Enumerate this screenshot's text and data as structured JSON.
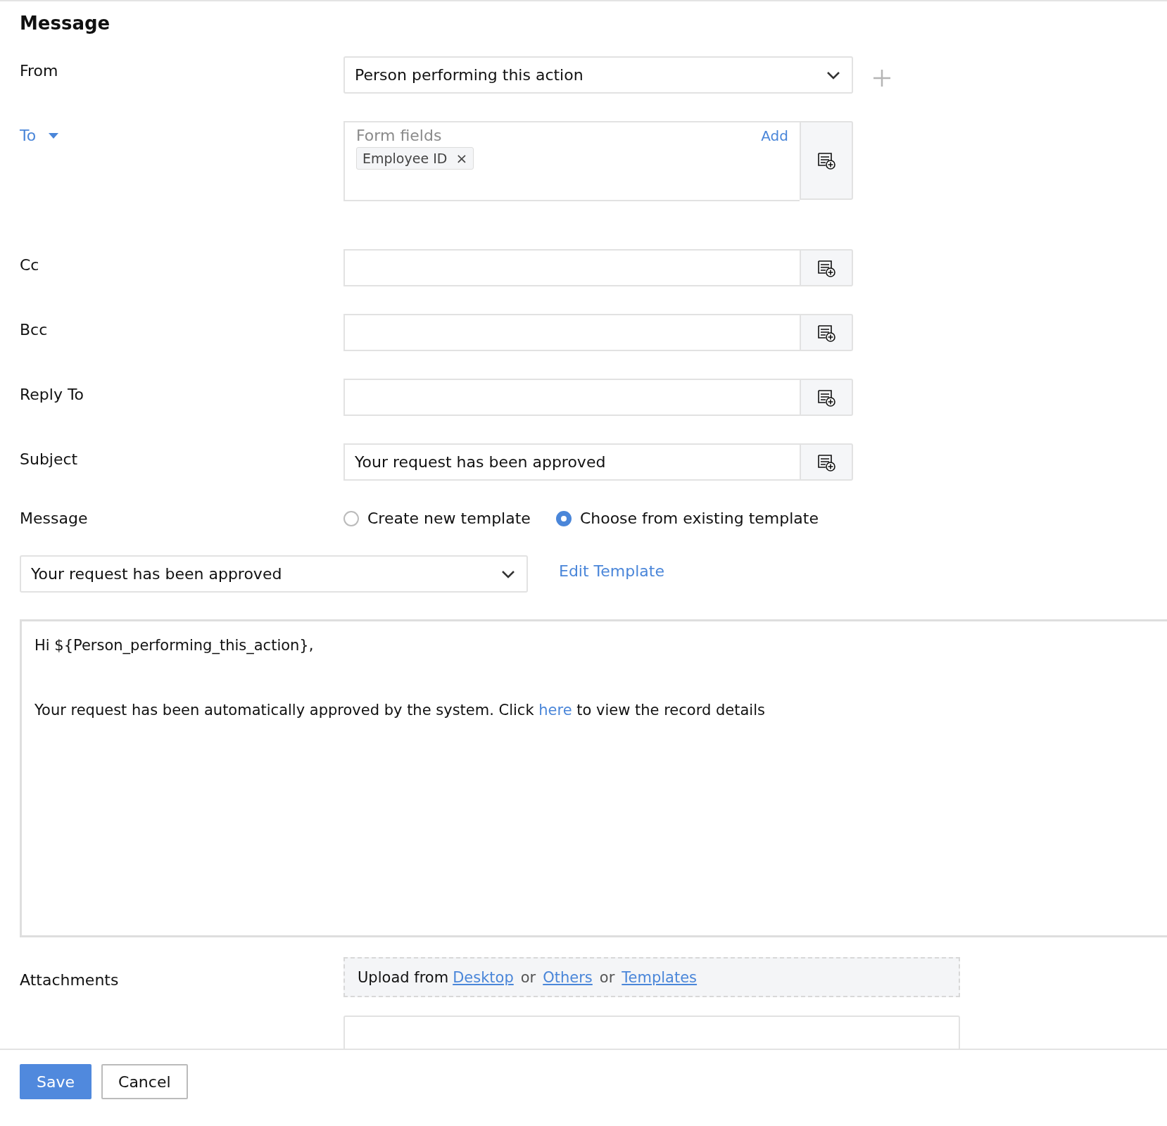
{
  "title": "Message",
  "from": {
    "label": "From",
    "value": "Person performing this action"
  },
  "to": {
    "label": "To",
    "placeholder": "Form fields",
    "add": "Add",
    "tokens": [
      {
        "label": "Employee ID",
        "remove": "×"
      }
    ]
  },
  "cc": {
    "label": "Cc"
  },
  "bcc": {
    "label": "Bcc"
  },
  "reply_to": {
    "label": "Reply To"
  },
  "subject": {
    "label": "Subject",
    "value": "Your request has been approved"
  },
  "message": {
    "label": "Message",
    "options": [
      {
        "label": "Create new template",
        "selected": false
      },
      {
        "label": "Choose from existing template",
        "selected": true
      }
    ],
    "template": "Your request has been approved",
    "edit": "Edit Template",
    "body": {
      "greeting": "Hi ${Person_performing_this_action},",
      "before": "Your request has been automatically approved by the system. Click ",
      "link": "here",
      "after": " to view the record details"
    }
  },
  "attachments": {
    "label": "Attachments",
    "parts": [
      {
        "kind": "text",
        "text": "Upload from"
      },
      {
        "kind": "link",
        "text": "Desktop"
      },
      {
        "kind": "sep",
        "text": "or"
      },
      {
        "kind": "link",
        "text": "Others"
      },
      {
        "kind": "sep",
        "text": "or"
      },
      {
        "kind": "link",
        "text": "Templates"
      }
    ]
  },
  "buttons": [
    {
      "label": "Save",
      "kind": "primary"
    },
    {
      "label": "Cancel",
      "kind": "secondary"
    }
  ]
}
